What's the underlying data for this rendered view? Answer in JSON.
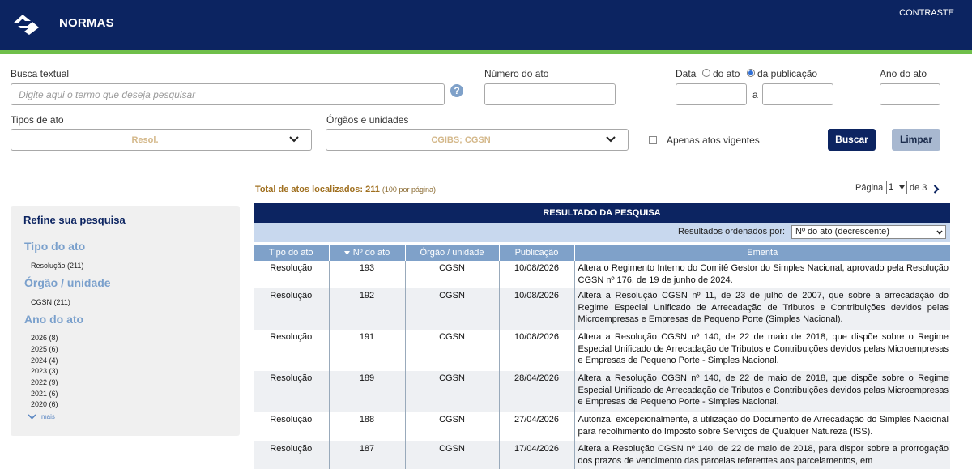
{
  "header": {
    "brand": "NORMAS",
    "contrast": "CONTRASTE",
    "colors": {
      "bar": "#0c2461",
      "stripe": "#6fbf4a"
    }
  },
  "search": {
    "text_label": "Busca textual",
    "text_placeholder": "Digite aqui o termo que deseja pesquisar",
    "help_glyph": "?",
    "number_label": "Número do ato",
    "date_label": "Data",
    "date_opt_act": "do ato",
    "date_opt_pub": "da publicação",
    "date_sep": "a",
    "year_label": "Ano do ato",
    "types_label": "Tipos de ato",
    "types_value": "Resol.",
    "organs_label": "Órgãos e unidades",
    "organs_value": "CGIBS; CGSN",
    "only_current": "Apenas atos vigentes",
    "search_btn": "Buscar",
    "clear_btn": "Limpar"
  },
  "results_meta": {
    "total": "Total de atos localizados: 211",
    "per_page": "(100 por página)",
    "page_label": "Página",
    "page_value": "1",
    "page_of": "de 3"
  },
  "refine": {
    "title": "Refine sua pesquisa",
    "type_title": "Tipo do ato",
    "type_items": [
      "Resolução (211)"
    ],
    "organ_title": "Órgão / unidade",
    "organ_items": [
      "CGSN (211)"
    ],
    "year_title": "Ano do ato",
    "year_items": [
      "2026 (8)",
      "2025 (6)",
      "2024 (4)",
      "2023 (3)",
      "2022 (9)",
      "2021 (6)",
      "2020 (6)"
    ],
    "more": "mais"
  },
  "table": {
    "heading": "RESULTADO DA PESQUISA",
    "order_label": "Resultados ordenados por:",
    "order_value": "Nº do ato (decrescente)",
    "columns": [
      "Tipo do ato",
      "Nº do ato",
      "Órgão / unidade",
      "Publicação",
      "Ementa"
    ],
    "rows": [
      {
        "tipo": "Resolução",
        "numero": "193",
        "orgao": "CGSN",
        "publicacao": "10/08/2026",
        "ementa": "Altera o Regimento Interno do Comitê Gestor do Simples Nacional, aprovado pela Resolução CGSN nº 176, de 19 de junho de 2024."
      },
      {
        "tipo": "Resolução",
        "numero": "192",
        "orgao": "CGSN",
        "publicacao": "10/08/2026",
        "ementa": "Altera a Resolução CGSN nº 11, de 23 de julho de 2007, que sobre a arrecadação do Regime Especial Unificado de Arrecadação de Tributos e Contribuições devidos pelas Microempresas e Empresas de Pequeno Porte (Simples Nacional)."
      },
      {
        "tipo": "Resolução",
        "numero": "191",
        "orgao": "CGSN",
        "publicacao": "10/08/2026",
        "ementa": "Altera a Resolução CGSN nº 140, de 22 de maio de 2018, que dispõe sobre o Regime Especial Unificado de Arrecadação de Tributos e Contribuições devidos pelas Microempresas e Empresas de Pequeno Porte - Simples Nacional."
      },
      {
        "tipo": "Resolução",
        "numero": "189",
        "orgao": "CGSN",
        "publicacao": "28/04/2026",
        "ementa": "Altera a Resolução CGSN nº 140, de 22 de maio de 2018, que dispõe sobre o Regime Especial Unificado de Arrecadação de Tributos e Contribuições devidos pelas Microempresas e Empresas de Pequeno Porte - Simples Nacional."
      },
      {
        "tipo": "Resolução",
        "numero": "188",
        "orgao": "CGSN",
        "publicacao": "27/04/2026",
        "ementa": "Autoriza, excepcionalmente, a utilização do Documento de Arrecadação do Simples Nacional para recolhimento do Imposto sobre Serviços de Qualquer Natureza (ISS)."
      },
      {
        "tipo": "Resolução",
        "numero": "187",
        "orgao": "CGSN",
        "publicacao": "17/04/2026",
        "ementa": "Altera a Resolução CGSN nº 140, de 22 de maio de 2018, para dispor sobre a prorrogação dos prazos de vencimento das parcelas referentes aos parcelamentos, em"
      }
    ]
  }
}
